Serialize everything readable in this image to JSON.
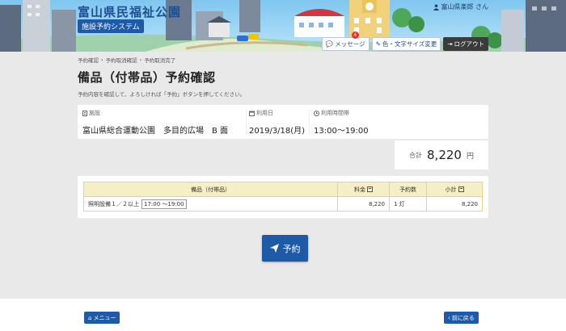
{
  "header": {
    "title": "富山県民福祉公園",
    "subtitle": "施設予約システム",
    "user_label": "富山県楽郎 さん",
    "buttons": {
      "message": "メッセージ",
      "message_count": "4",
      "text_size": "色・文字サイズ変更",
      "logout": "ログアウト"
    }
  },
  "breadcrumb": [
    "予約確認",
    "予約取消確認",
    "予約取消完了"
  ],
  "page": {
    "title": "備品（付帯品）予約確認",
    "description": "予約内容を確認して、よろしければ「予約」ボタンを押してください。"
  },
  "info": {
    "facility_label": "施設",
    "facility_value": "富山県総合運動公園　多目的広場　B 面",
    "date_label": "利用日",
    "date_value": "2019/3/18(月)",
    "time_label": "利用時間帯",
    "time_value": "13:00〜19:00"
  },
  "total": {
    "label": "合計",
    "amount": "8,220",
    "unit": "円"
  },
  "table": {
    "headers": {
      "item": "備品（付帯品）",
      "fee": "料金",
      "count": "予約数",
      "subtotal": "小計"
    },
    "rows": [
      {
        "item": "照明設備１／２以上",
        "time": "17:00 〜19:00",
        "fee": "8,220",
        "count": "1 灯",
        "subtotal": "8,220"
      }
    ]
  },
  "reserve_button": "予約",
  "footer": {
    "menu": "メニュー",
    "back": "前に戻る"
  },
  "colors": {
    "brand": "#1f5aa6",
    "table_border": "#d5b24d",
    "table_header": "#f6eec4",
    "badge": "#e0342f"
  }
}
